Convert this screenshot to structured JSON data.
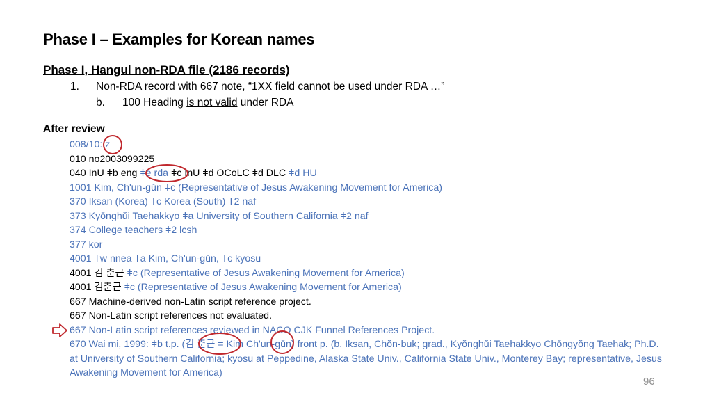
{
  "slide": {
    "title": "Phase I – Examples for Korean names",
    "subtitle": "Phase I,  Hangul non-RDA file (2186 records)",
    "item1_num": "1.",
    "item1_text": "Non-RDA record with 667 note, “1XX field cannot be used under RDA …”",
    "item1b_num": "b.",
    "item1b_pre": "100 Heading ",
    "item1b_underlined": "is not valid",
    "item1b_post": " under RDA",
    "after_review": "After review",
    "page_number": "96"
  },
  "record": {
    "l1": "008/10: z",
    "l2": "010  no2003099225",
    "l3a": "040  InU ǂb eng ",
    "l3b": "ǂe rda ",
    "l3c": "ǂc InU ǂd OCoLC ǂd DLC ",
    "l3d": "ǂd HU",
    "l4": "1001 Kim, Ch'un-gŭn ǂc (Representative of Jesus Awakening Movement for America)",
    "l5": "370  Iksan (Korea) ǂc Korea (South) ǂ2 naf",
    "l6": "373  Kyŏnghŭi Taehakkyo ǂa University of Southern California ǂ2 naf",
    "l7": "374  College teachers ǂ2 lcsh",
    "l8": "377  kor",
    "l9": "4001 ǂw nnea ǂa Kim, Ch'un-gŭn, ǂc kyosu",
    "l10a": "4001  김 춘근  ",
    "l10b": "ǂc (Representative of Jesus Awakening Movement for America)",
    "l11a": "4001  김춘근  ",
    "l11b": "ǂc (Representative of Jesus Awakening Movement for America)",
    "l12": "667  Machine-derived non-Latin script reference project.",
    "l13": "667  Non-Latin script references not evaluated.",
    "l14": "667  Non-Latin script references reviewed in NACO CJK Funnel References Project.",
    "l15": "670  Wai mi, 1999: ǂb t.p. (김 춘근 = Kim Ch'un-gŭn) front p. (b. Iksan, Chŏn-buk; grad., Kyŏnghŭi Taehakkyo Chŏngyŏng Taehak; Ph.D. at University of Southern California; kyosu at Peppedine, Alaska State Univ., California State Univ., Monterey Bay; representative, Jesus Awakening Movement for America)"
  },
  "colors": {
    "blue_text": "#4a72b8",
    "annotation_red": "#c0282d",
    "page_number_gray": "#8c8c8c"
  }
}
